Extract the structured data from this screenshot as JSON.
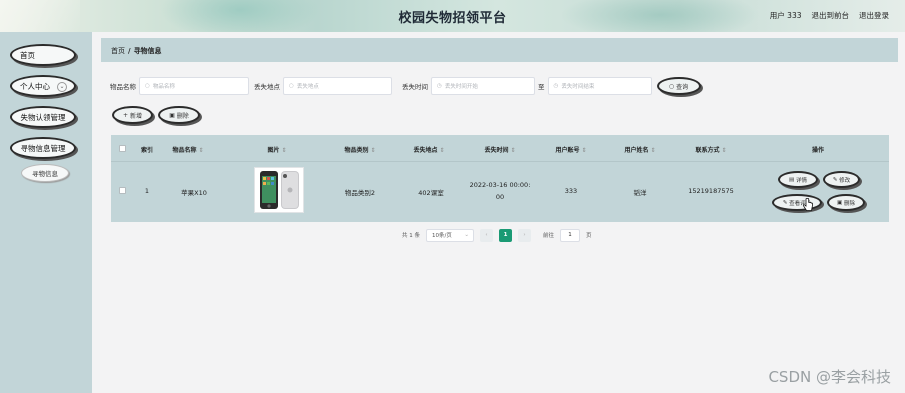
{
  "header": {
    "title": "校园失物招领平台",
    "user": "用户 333",
    "back_front": "退出到前台",
    "logout": "退出登录"
  },
  "sidebar": {
    "items": [
      {
        "label": "首页"
      },
      {
        "label": "个人中心"
      },
      {
        "label": "失物认领管理"
      },
      {
        "label": "寻物信息管理"
      }
    ],
    "sub_item": "寻物信息",
    "expand_icon": "chevron-down-icon"
  },
  "breadcrumb": {
    "home": "首页",
    "separator": "/",
    "current": "寻物信息"
  },
  "search": {
    "name_label": "物品名称",
    "name_placeholder": "物品名称",
    "place_label": "丢失地点",
    "place_placeholder": "丢失地点",
    "time_label": "丢失时间",
    "time_start_placeholder": "丢失时间开始",
    "time_to": "至",
    "time_end_placeholder": "丢失时间结束",
    "query_button": "查询"
  },
  "actions": {
    "add": "新增",
    "delete": "删除"
  },
  "table": {
    "headers": {
      "index": "索引",
      "name": "物品名称",
      "image": "图片",
      "category": "物品类别",
      "place": "丢失地点",
      "time": "丢失时间",
      "account": "用户账号",
      "username": "用户姓名",
      "contact": "联系方式",
      "ops": "操作"
    },
    "sort_glyph": "⇕",
    "rows": [
      {
        "index": "1",
        "name": "苹果X10",
        "category": "物品类别2",
        "place": "402课室",
        "time_line1": "2022-03-16 00:00:",
        "time_line2": "00",
        "account": "333",
        "username": "韬洋",
        "contact": "15219187575",
        "op_detail": "详情",
        "op_edit": "修改",
        "op_comment": "查看评论",
        "op_delete": "删除"
      }
    ]
  },
  "pagination": {
    "total": "共 1 条",
    "page_size": "10条/页",
    "current_page": "1",
    "goto_label": "前往",
    "goto_value": "1",
    "page_unit": "页"
  },
  "watermark": "CSDN @李会科技",
  "colors": {
    "sidebar_bg": "#c2d5d8",
    "page_active": "#1a9a74",
    "content_bg": "#f3f3f4"
  }
}
